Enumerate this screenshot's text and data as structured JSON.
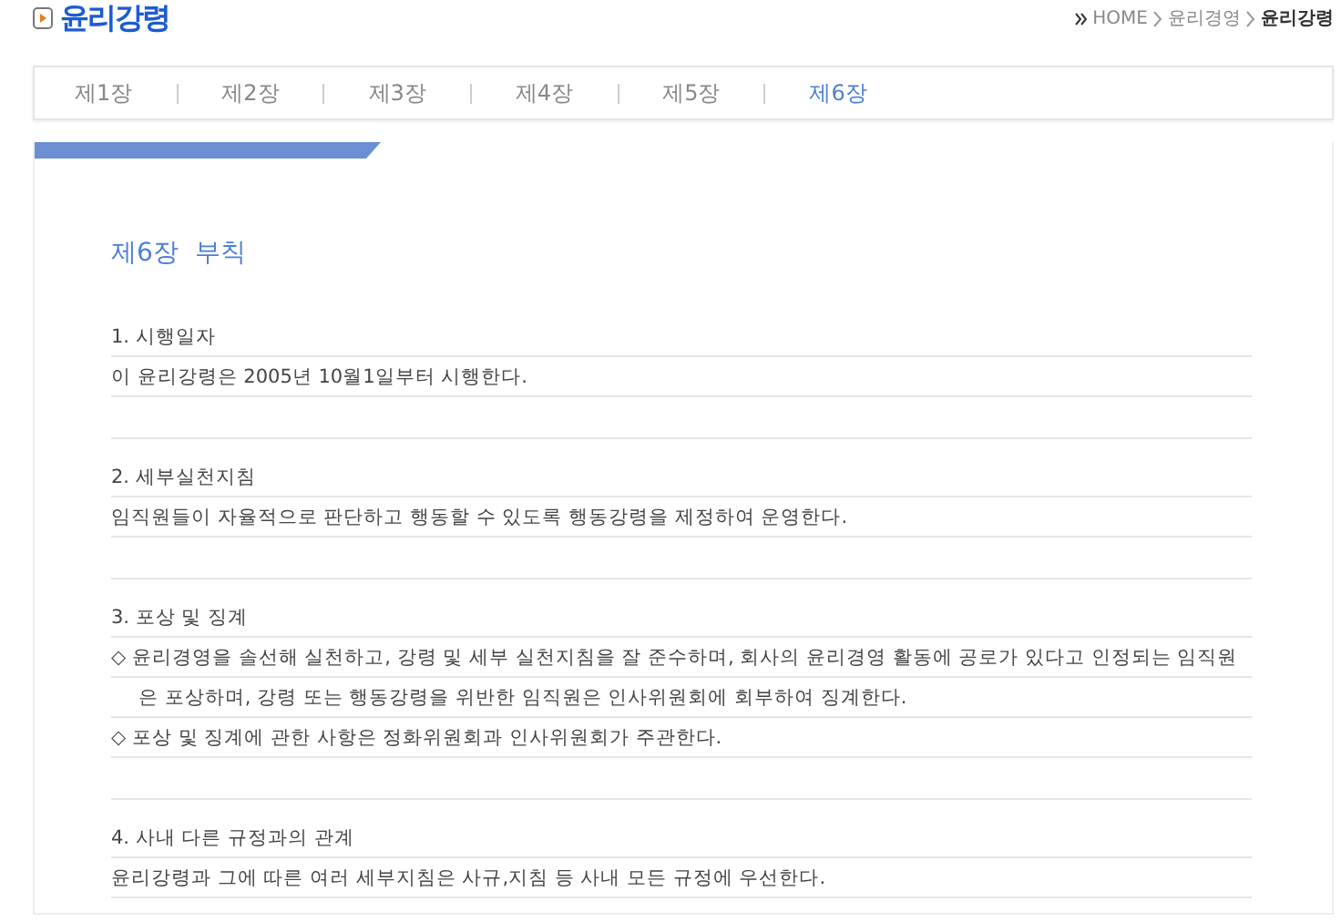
{
  "page_title": "윤리강령",
  "breadcrumb": [
    "HOME",
    "윤리경영",
    "윤리강령"
  ],
  "tabs": [
    {
      "label": "제1장",
      "selected": false
    },
    {
      "label": "제2장",
      "selected": false
    },
    {
      "label": "제3장",
      "selected": false
    },
    {
      "label": "제4장",
      "selected": false
    },
    {
      "label": "제5장",
      "selected": false
    },
    {
      "label": "제6장",
      "selected": true
    }
  ],
  "chapter_title": "제6장  부칙",
  "sections": [
    {
      "heading": "1. 시행일자",
      "paragraphs": [
        {
          "kind": "plain",
          "text": "이 윤리강령은 2005년 10월1일부터 시행한다."
        }
      ]
    },
    {
      "heading": "2. 세부실천지침",
      "paragraphs": [
        {
          "kind": "plain",
          "text": "임직원들이 자율적으로 판단하고 행동할 수 있도록 행동강령을 제정하여 운영한다."
        }
      ]
    },
    {
      "heading": "3. 포상 및 징계",
      "paragraphs": [
        {
          "kind": "bullet",
          "text": "◇ 윤리경영을 솔선해 실천하고, 강령 및 세부 실천지침을 잘 준수하며, 회사의 윤리경영 활동에 공로가 있다고 인정되는 임직원은 포상하며, 강령 또는 행동강령을 위반한 임직원은 인사위원회에 회부하여 징계한다."
        },
        {
          "kind": "bullet",
          "text": "◇ 포상 및 징계에 관한 사항은 정화위원회과 인사위원회가 주관한다."
        }
      ]
    },
    {
      "heading": "4. 사내 다른 규정과의 관계",
      "paragraphs": [
        {
          "kind": "plain",
          "text": "윤리강령과 그에 따른 여러 세부지침은 사규,지침 등 사내 모든 규정에 우선한다."
        }
      ]
    }
  ]
}
